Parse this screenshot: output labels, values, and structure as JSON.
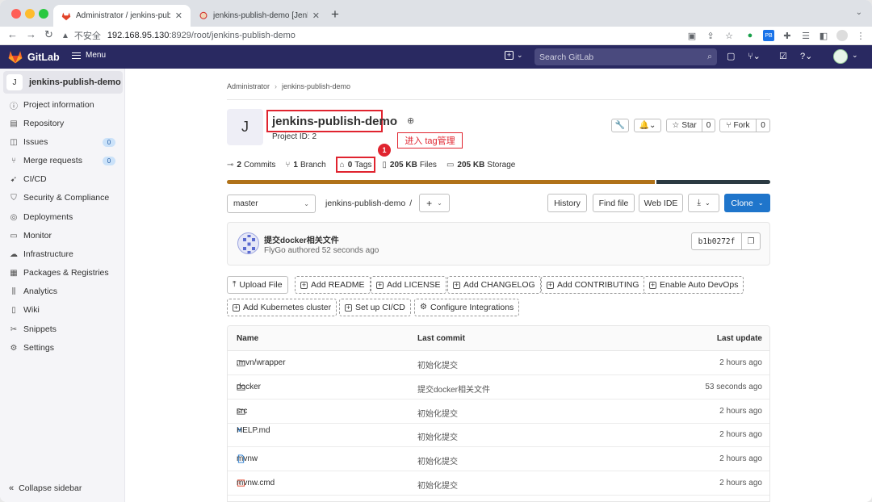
{
  "browser": {
    "tabs": [
      {
        "title": "Administrator / jenkins-publish-demo · GitLab",
        "active": true
      },
      {
        "title": "jenkins-publish-demo [Jenkins]",
        "active": false
      }
    ],
    "url_warning": "不安全",
    "url_host": "192.168.95.130",
    "url_rest": ":8929/root/jenkins-publish-demo"
  },
  "header": {
    "logo": "GitLab",
    "menu": "Menu",
    "search_placeholder": "Search GitLab"
  },
  "sidebar": {
    "project_initial": "J",
    "project_name": "jenkins-publish-demo",
    "items": [
      {
        "label": "Project information",
        "icon": "info-icon"
      },
      {
        "label": "Repository",
        "icon": "repository-icon"
      },
      {
        "label": "Issues",
        "icon": "issues-icon",
        "badge": "0"
      },
      {
        "label": "Merge requests",
        "icon": "merge-request-icon",
        "badge": "0"
      },
      {
        "label": "CI/CD",
        "icon": "rocket-icon"
      },
      {
        "label": "Security & Compliance",
        "icon": "shield-icon"
      },
      {
        "label": "Deployments",
        "icon": "deployments-icon"
      },
      {
        "label": "Monitor",
        "icon": "monitor-icon"
      },
      {
        "label": "Infrastructure",
        "icon": "cloud-icon"
      },
      {
        "label": "Packages & Registries",
        "icon": "package-icon"
      },
      {
        "label": "Analytics",
        "icon": "chart-icon"
      },
      {
        "label": "Wiki",
        "icon": "book-icon"
      },
      {
        "label": "Snippets",
        "icon": "scissors-icon"
      },
      {
        "label": "Settings",
        "icon": "gear-icon"
      }
    ],
    "collapse": "Collapse sidebar"
  },
  "breadcrumb": [
    "Administrator",
    "jenkins-publish-demo"
  ],
  "project": {
    "initial": "J",
    "title": "jenkins-publish-demo",
    "id_text": "Project ID: 2",
    "star_label": "Star",
    "star_count": "0",
    "fork_label": "Fork",
    "fork_count": "0"
  },
  "annotation": {
    "marker": "1",
    "text": "进入 tag管理"
  },
  "stats": {
    "commits_num": "2",
    "commits_label": "Commits",
    "branch_num": "1",
    "branch_label": "Branch",
    "tags_num": "0",
    "tags_label": "Tags",
    "files_num": "205 KB",
    "files_label": "Files",
    "storage_num": "205 KB",
    "storage_label": "Storage"
  },
  "language_bar": [
    {
      "share": 0.79,
      "color": "#b07219"
    },
    {
      "share": 0.21,
      "color": "#2b3a42"
    }
  ],
  "repo_bar": {
    "branch": "master",
    "path": "jenkins-publish-demo",
    "history": "History",
    "find_file": "Find file",
    "web_ide": "Web IDE",
    "clone": "Clone"
  },
  "commit": {
    "message": "提交docker相关文件",
    "meta": "FlyGo authored 52 seconds ago",
    "sha": "b1b0272f"
  },
  "quick_actions": {
    "upload": "Upload File",
    "readme": "Add README",
    "license": "Add LICENSE",
    "changelog": "Add CHANGELOG",
    "contributing": "Add CONTRIBUTING",
    "autodevops": "Enable Auto DevOps",
    "kubernetes": "Add Kubernetes cluster",
    "cicd": "Set up CI/CD",
    "integrations": "Configure Integrations"
  },
  "files": {
    "headers": [
      "Name",
      "Last commit",
      "Last update"
    ],
    "rows": [
      {
        "name": ".mvn/wrapper",
        "commit": "初始化提交",
        "updated": "2 hours ago",
        "type": "folder"
      },
      {
        "name": "docker",
        "commit": "提交docker相关文件",
        "updated": "53 seconds ago",
        "type": "folder"
      },
      {
        "name": "src",
        "commit": "初始化提交",
        "updated": "2 hours ago",
        "type": "folder"
      },
      {
        "name": "HELP.md",
        "commit": "初始化提交",
        "updated": "2 hours ago",
        "type": "markdown"
      },
      {
        "name": "mvnw",
        "commit": "初始化提交",
        "updated": "2 hours ago",
        "type": "file"
      },
      {
        "name": "mvnw.cmd",
        "commit": "初始化提交",
        "updated": "2 hours ago",
        "type": "cmd"
      }
    ]
  }
}
